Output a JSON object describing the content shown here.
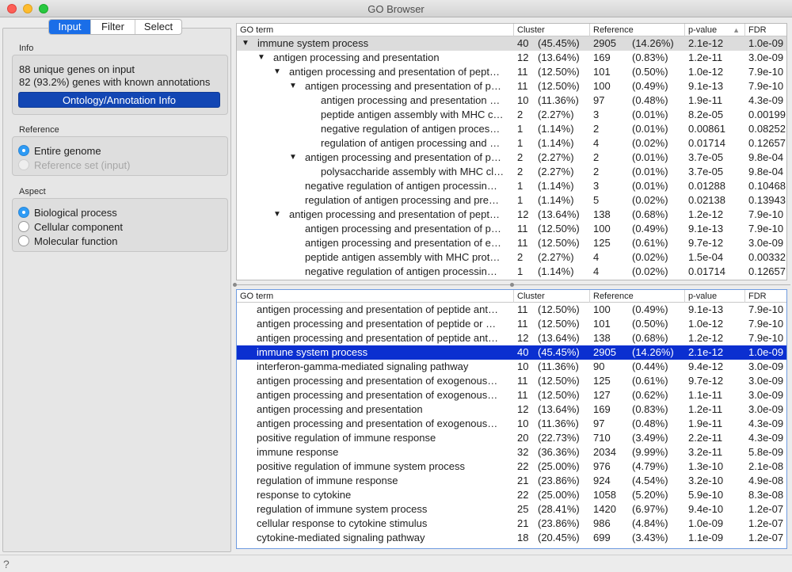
{
  "window": {
    "title": "GO Browser"
  },
  "tabs": [
    "Input",
    "Filter",
    "Select"
  ],
  "active_tab": "Input",
  "info": {
    "group_label": "Info",
    "line1": "88 unique genes on input",
    "line2": "82 (93.2%) genes with known annotations",
    "button": "Ontology/Annotation Info"
  },
  "reference": {
    "group_label": "Reference",
    "options": [
      {
        "label": "Entire genome",
        "checked": true,
        "enabled": true
      },
      {
        "label": "Reference set (input)",
        "checked": false,
        "enabled": false
      }
    ]
  },
  "aspect": {
    "group_label": "Aspect",
    "options": [
      {
        "label": "Biological process",
        "checked": true
      },
      {
        "label": "Cellular component",
        "checked": false
      },
      {
        "label": "Molecular function",
        "checked": false
      }
    ]
  },
  "columns": [
    "GO term",
    "Cluster",
    "Reference",
    "p-value",
    "FDR"
  ],
  "tree_rows": [
    {
      "level": 0,
      "expanded": true,
      "term": "immune system process",
      "cn": "40",
      "cp": "(45.45%)",
      "rn": "2905",
      "rp": "(14.26%)",
      "pv": "2.1e-12",
      "fdr": "1.0e-09"
    },
    {
      "level": 1,
      "expanded": true,
      "term": "antigen processing and presentation",
      "cn": "12",
      "cp": "(13.64%)",
      "rn": "169",
      "rp": "(0.83%)",
      "pv": "1.2e-11",
      "fdr": "3.0e-09"
    },
    {
      "level": 2,
      "expanded": true,
      "term": "antigen processing and presentation of pept…",
      "cn": "11",
      "cp": "(12.50%)",
      "rn": "101",
      "rp": "(0.50%)",
      "pv": "1.0e-12",
      "fdr": "7.9e-10"
    },
    {
      "level": 3,
      "expanded": true,
      "term": "antigen processing and presentation of p…",
      "cn": "11",
      "cp": "(12.50%)",
      "rn": "100",
      "rp": "(0.49%)",
      "pv": "9.1e-13",
      "fdr": "7.9e-10"
    },
    {
      "level": 4,
      "expanded": false,
      "term": "antigen processing and presentation …",
      "cn": "10",
      "cp": "(11.36%)",
      "rn": "97",
      "rp": "(0.48%)",
      "pv": "1.9e-11",
      "fdr": "4.3e-09"
    },
    {
      "level": 4,
      "expanded": false,
      "term": "peptide antigen assembly with MHC c…",
      "cn": "2",
      "cp": "(2.27%)",
      "rn": "3",
      "rp": "(0.01%)",
      "pv": "8.2e-05",
      "fdr": "0.00199"
    },
    {
      "level": 4,
      "expanded": false,
      "term": "negative regulation of antigen proces…",
      "cn": "1",
      "cp": "(1.14%)",
      "rn": "2",
      "rp": "(0.01%)",
      "pv": "0.00861",
      "fdr": "0.08252"
    },
    {
      "level": 4,
      "expanded": false,
      "term": "regulation of antigen processing and …",
      "cn": "1",
      "cp": "(1.14%)",
      "rn": "4",
      "rp": "(0.02%)",
      "pv": "0.01714",
      "fdr": "0.12657"
    },
    {
      "level": 3,
      "expanded": true,
      "term": "antigen processing and presentation of p…",
      "cn": "2",
      "cp": "(2.27%)",
      "rn": "2",
      "rp": "(0.01%)",
      "pv": "3.7e-05",
      "fdr": "9.8e-04"
    },
    {
      "level": 4,
      "expanded": false,
      "term": "polysaccharide assembly with MHC cl…",
      "cn": "2",
      "cp": "(2.27%)",
      "rn": "2",
      "rp": "(0.01%)",
      "pv": "3.7e-05",
      "fdr": "9.8e-04"
    },
    {
      "level": 3,
      "expanded": false,
      "term": "negative regulation of antigen processin…",
      "cn": "1",
      "cp": "(1.14%)",
      "rn": "3",
      "rp": "(0.01%)",
      "pv": "0.01288",
      "fdr": "0.10468"
    },
    {
      "level": 3,
      "expanded": false,
      "term": "regulation of antigen processing and pre…",
      "cn": "1",
      "cp": "(1.14%)",
      "rn": "5",
      "rp": "(0.02%)",
      "pv": "0.02138",
      "fdr": "0.13943"
    },
    {
      "level": 2,
      "expanded": true,
      "term": "antigen processing and presentation of pept…",
      "cn": "12",
      "cp": "(13.64%)",
      "rn": "138",
      "rp": "(0.68%)",
      "pv": "1.2e-12",
      "fdr": "7.9e-10"
    },
    {
      "level": 3,
      "expanded": false,
      "term": "antigen processing and presentation of p…",
      "cn": "11",
      "cp": "(12.50%)",
      "rn": "100",
      "rp": "(0.49%)",
      "pv": "9.1e-13",
      "fdr": "7.9e-10"
    },
    {
      "level": 3,
      "expanded": false,
      "term": "antigen processing and presentation of e…",
      "cn": "11",
      "cp": "(12.50%)",
      "rn": "125",
      "rp": "(0.61%)",
      "pv": "9.7e-12",
      "fdr": "3.0e-09"
    },
    {
      "level": 3,
      "expanded": false,
      "term": "peptide antigen assembly with MHC prot…",
      "cn": "2",
      "cp": "(2.27%)",
      "rn": "4",
      "rp": "(0.02%)",
      "pv": "1.5e-04",
      "fdr": "0.00332"
    },
    {
      "level": 3,
      "expanded": false,
      "term": "negative regulation of antigen processin…",
      "cn": "1",
      "cp": "(1.14%)",
      "rn": "4",
      "rp": "(0.02%)",
      "pv": "0.01714",
      "fdr": "0.12657"
    }
  ],
  "list_rows": [
    {
      "term": "antigen processing and presentation of peptide ant…",
      "cn": "11",
      "cp": "(12.50%)",
      "rn": "100",
      "rp": "(0.49%)",
      "pv": "9.1e-13",
      "fdr": "7.9e-10"
    },
    {
      "term": "antigen processing and presentation of peptide or …",
      "cn": "11",
      "cp": "(12.50%)",
      "rn": "101",
      "rp": "(0.50%)",
      "pv": "1.0e-12",
      "fdr": "7.9e-10"
    },
    {
      "term": "antigen processing and presentation of peptide ant…",
      "cn": "12",
      "cp": "(13.64%)",
      "rn": "138",
      "rp": "(0.68%)",
      "pv": "1.2e-12",
      "fdr": "7.9e-10"
    },
    {
      "term": "immune system process",
      "cn": "40",
      "cp": "(45.45%)",
      "rn": "2905",
      "rp": "(14.26%)",
      "pv": "2.1e-12",
      "fdr": "1.0e-09",
      "selected": true
    },
    {
      "term": "interferon-gamma-mediated signaling pathway",
      "cn": "10",
      "cp": "(11.36%)",
      "rn": "90",
      "rp": "(0.44%)",
      "pv": "9.4e-12",
      "fdr": "3.0e-09"
    },
    {
      "term": "antigen processing and presentation of exogenous…",
      "cn": "11",
      "cp": "(12.50%)",
      "rn": "125",
      "rp": "(0.61%)",
      "pv": "9.7e-12",
      "fdr": "3.0e-09"
    },
    {
      "term": "antigen processing and presentation of exogenous…",
      "cn": "11",
      "cp": "(12.50%)",
      "rn": "127",
      "rp": "(0.62%)",
      "pv": "1.1e-11",
      "fdr": "3.0e-09"
    },
    {
      "term": "antigen processing and presentation",
      "cn": "12",
      "cp": "(13.64%)",
      "rn": "169",
      "rp": "(0.83%)",
      "pv": "1.2e-11",
      "fdr": "3.0e-09"
    },
    {
      "term": "antigen processing and presentation of exogenous…",
      "cn": "10",
      "cp": "(11.36%)",
      "rn": "97",
      "rp": "(0.48%)",
      "pv": "1.9e-11",
      "fdr": "4.3e-09"
    },
    {
      "term": "positive regulation of immune response",
      "cn": "20",
      "cp": "(22.73%)",
      "rn": "710",
      "rp": "(3.49%)",
      "pv": "2.2e-11",
      "fdr": "4.3e-09"
    },
    {
      "term": "immune response",
      "cn": "32",
      "cp": "(36.36%)",
      "rn": "2034",
      "rp": "(9.99%)",
      "pv": "3.2e-11",
      "fdr": "5.8e-09"
    },
    {
      "term": "positive regulation of immune system process",
      "cn": "22",
      "cp": "(25.00%)",
      "rn": "976",
      "rp": "(4.79%)",
      "pv": "1.3e-10",
      "fdr": "2.1e-08"
    },
    {
      "term": "regulation of immune response",
      "cn": "21",
      "cp": "(23.86%)",
      "rn": "924",
      "rp": "(4.54%)",
      "pv": "3.2e-10",
      "fdr": "4.9e-08"
    },
    {
      "term": "response to cytokine",
      "cn": "22",
      "cp": "(25.00%)",
      "rn": "1058",
      "rp": "(5.20%)",
      "pv": "5.9e-10",
      "fdr": "8.3e-08"
    },
    {
      "term": "regulation of immune system process",
      "cn": "25",
      "cp": "(28.41%)",
      "rn": "1420",
      "rp": "(6.97%)",
      "pv": "9.4e-10",
      "fdr": "1.2e-07"
    },
    {
      "term": "cellular response to cytokine stimulus",
      "cn": "21",
      "cp": "(23.86%)",
      "rn": "986",
      "rp": "(4.84%)",
      "pv": "1.0e-09",
      "fdr": "1.2e-07"
    },
    {
      "term": "cytokine-mediated signaling pathway",
      "cn": "18",
      "cp": "(20.45%)",
      "rn": "699",
      "rp": "(3.43%)",
      "pv": "1.1e-09",
      "fdr": "1.2e-07"
    }
  ],
  "status": {
    "help_glyph": "?"
  },
  "colors": {
    "accent": "#1a6ee8",
    "selection": "#0b2fd0",
    "info_button": "#1246b4"
  }
}
